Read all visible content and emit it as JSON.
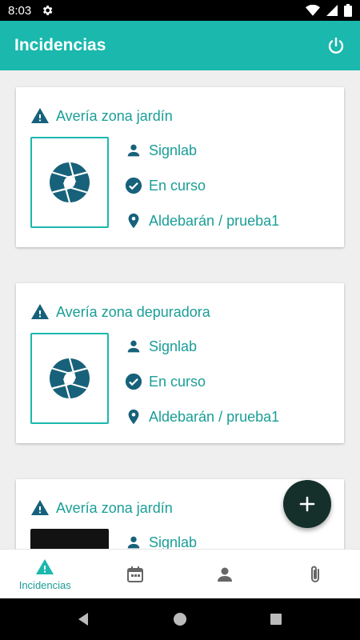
{
  "status_bar": {
    "time": "8:03"
  },
  "app_bar": {
    "title": "Incidencias"
  },
  "colors": {
    "primary": "#1ab8ad",
    "accent_text": "#1a9e97",
    "icon_dark": "#17627a",
    "fab": "#15302b"
  },
  "incidents": [
    {
      "title": "Avería zona jardín",
      "user": "Signlab",
      "status": "En curso",
      "location": "Aldebarán / prueba1",
      "thumbnail": "placeholder-camera"
    },
    {
      "title": "Avería zona depuradora",
      "user": "Signlab",
      "status": "En curso",
      "location": "Aldebarán / prueba1",
      "thumbnail": "placeholder-camera"
    },
    {
      "title": "Avería zona jardín",
      "user": "Signlab",
      "thumbnail": "photo"
    }
  ],
  "bottom_nav": [
    {
      "label": "Incidencias",
      "icon": "warning-icon",
      "active": true
    },
    {
      "label": "",
      "icon": "calendar-icon"
    },
    {
      "label": "",
      "icon": "person-icon"
    },
    {
      "label": "",
      "icon": "paperclip-icon"
    }
  ]
}
